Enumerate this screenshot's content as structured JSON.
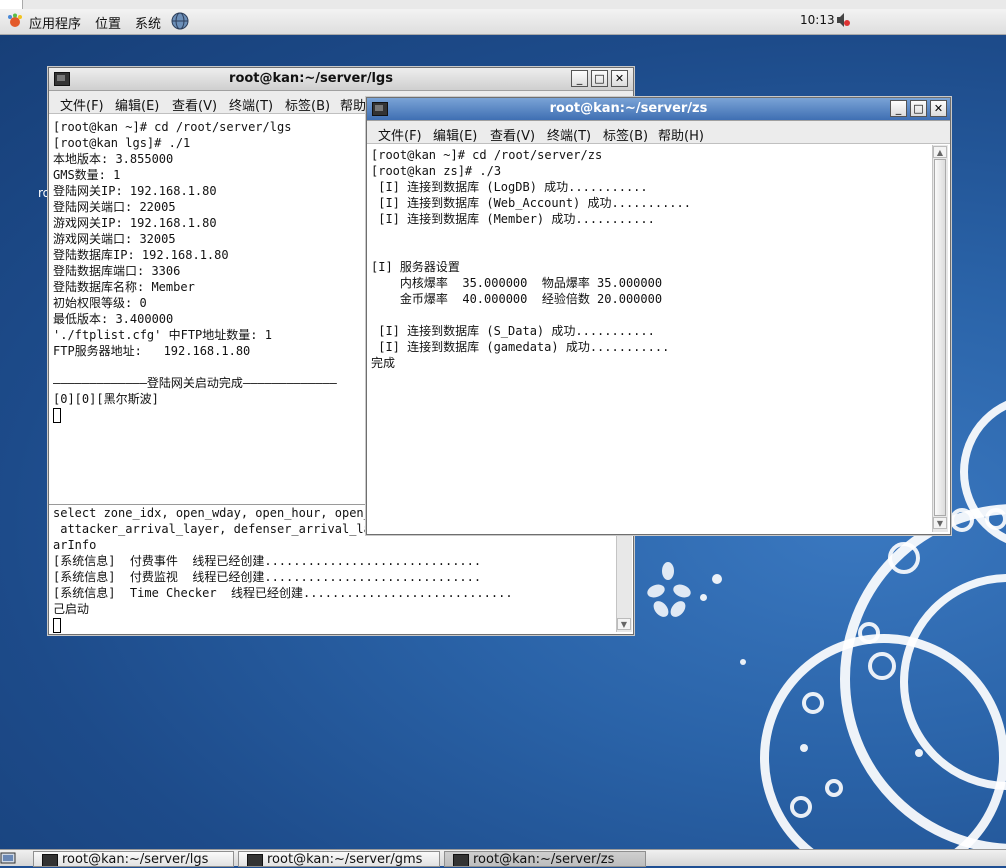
{
  "panel": {
    "menus": [
      "应用程序",
      "位置",
      "系统"
    ],
    "clock": "10:13"
  },
  "desktop": {
    "partial_text": "ro"
  },
  "windows": {
    "lgs": {
      "title": "root@kan:~/server/lgs",
      "menu": [
        "文件(F)",
        "编辑(E)",
        "查看(V)",
        "终端(T)",
        "标签(B)",
        "帮助("
      ],
      "top_lines": [
        "[root@kan ~]# cd /root/server/lgs",
        "[root@kan lgs]# ./1",
        "本地版本: 3.855000",
        "GMS数量: 1",
        "登陆网关IP: 192.168.1.80",
        "登陆网关端口: 22005",
        "游戏网关IP: 192.168.1.80",
        "游戏网关端口: 32005",
        "登陆数据库IP: 192.168.1.80",
        "登陆数据库端口: 3306",
        "登陆数据库名称: Member",
        "初始权限等级: 0",
        "最低版本: 3.400000",
        "'./ftplist.cfg' 中FTP地址数量: 1",
        "FTP服务器地址:   192.168.1.80",
        "",
        "—————————————登陆网关启动完成—————————————",
        "[0][0][黑尔斯波]"
      ],
      "bottom_lines": [
        "select zone_idx, open_wday, open_hour, open_m",
        " attacker_arrival_layer, defenser_arrival_lay",
        "arInfo",
        "[系统信息]  付费事件  线程已经创建..............................",
        "[系统信息]  付费监视  线程已经创建..............................",
        "[系统信息]  Time Checker  线程已经创建.............................",
        "己启动"
      ]
    },
    "zs": {
      "title": "root@kan:~/server/zs",
      "menu": [
        "文件(F)",
        "编辑(E)",
        "查看(V)",
        "终端(T)",
        "标签(B)",
        "帮助(H)"
      ],
      "lines": [
        "[root@kan ~]# cd /root/server/zs",
        "[root@kan zs]# ./3",
        " [I] 连接到数据库 (LogDB) 成功...........",
        " [I] 连接到数据库 (Web_Account) 成功...........",
        " [I] 连接到数据库 (Member) 成功...........",
        "",
        "",
        "[I] 服务器设置",
        "    内核爆率  35.000000  物品爆率 35.000000",
        "    金币爆率  40.000000  经验倍数 20.000000",
        "",
        " [I] 连接到数据库 (S_Data) 成功...........",
        " [I] 连接到数据库 (gamedata) 成功...........",
        "完成"
      ]
    }
  },
  "taskbar": {
    "items": [
      {
        "label": "root@kan:~/server/lgs"
      },
      {
        "label": "root@kan:~/server/gms"
      },
      {
        "label": "root@kan:~/server/zs"
      }
    ]
  },
  "colors": {
    "desktop_blue": "#1f4f93",
    "active_title": "#3f6fb3"
  }
}
